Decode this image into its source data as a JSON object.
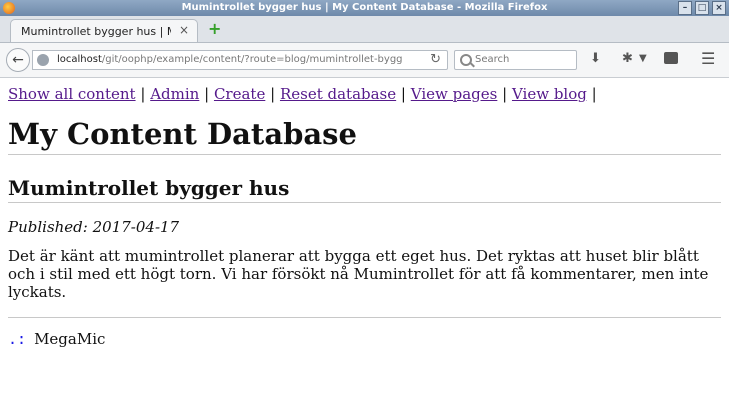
{
  "window": {
    "title": "Mumintrollet bygger hus | My Content Database - Mozilla Firefox"
  },
  "tab": {
    "title": "Mumintrollet bygger hus | M...",
    "close_label": "×",
    "new_tab_label": "+"
  },
  "urlbar": {
    "host": "localhost",
    "path": "/git/oophp/example/content/?route=blog/mumintrollet-bygg"
  },
  "search": {
    "placeholder": "Search"
  },
  "page": {
    "nav": [
      "Show all content",
      "Admin",
      "Create",
      "Reset database",
      "View pages",
      "View blog"
    ],
    "separator": "|",
    "site_title": "My Content Database",
    "post_title": "Mumintrollet bygger hus",
    "published": "Published: 2017-04-17",
    "body": "Det är känt att mumintrollet planerar att bygga ett eget hus. Det ryktas att huset blir blått och i stil med ett högt torn. Vi har försökt nå Mumintrollet för att få kommentarer, men inte lyckats.",
    "footer_dots": ".:",
    "footer_text": "MegaMic"
  }
}
